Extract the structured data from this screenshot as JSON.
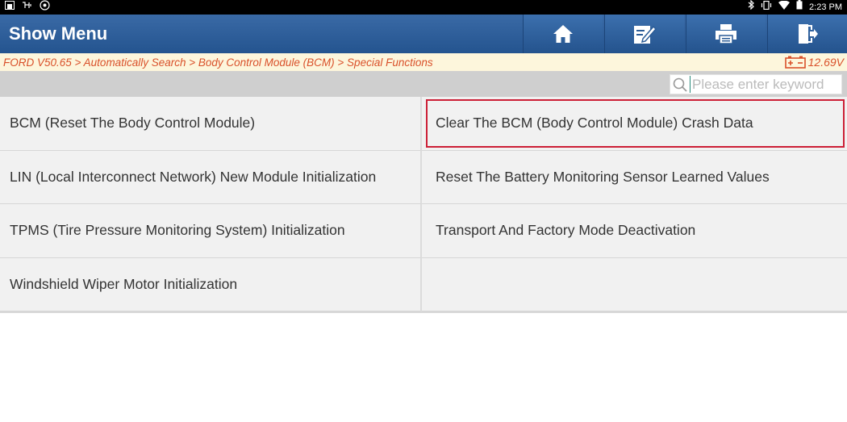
{
  "status_bar": {
    "left_icons": [
      "home-icon",
      "usb-debug-icon",
      "settings-icon"
    ],
    "right_icons": [
      "bluetooth-icon",
      "vibrate-icon",
      "wifi-icon",
      "battery-icon"
    ],
    "time": "2:23 PM"
  },
  "header": {
    "title": "Show Menu",
    "buttons": [
      {
        "name": "home-button",
        "icon": "home-icon"
      },
      {
        "name": "edit-button",
        "icon": "edit-icon"
      },
      {
        "name": "print-button",
        "icon": "print-icon"
      },
      {
        "name": "exit-button",
        "icon": "exit-icon"
      }
    ]
  },
  "breadcrumb": {
    "path": "FORD V50.65 > Automatically Search > Body Control Module (BCM) > Special Functions",
    "voltage": "12.69V",
    "voltage_icon": "battery-voltage-icon"
  },
  "search": {
    "placeholder": "Please enter keyword",
    "value": ""
  },
  "menu": {
    "items": [
      "BCM (Reset The Body Control Module)",
      "Clear The BCM (Body Control Module) Crash Data",
      "LIN (Local Interconnect Network) New Module Initialization",
      "Reset The Battery Monitoring Sensor Learned Values",
      "TPMS (Tire Pressure Monitoring System) Initialization",
      "Transport And Factory Mode Deactivation",
      "Windshield Wiper Motor Initialization",
      ""
    ],
    "selected_index": 1
  },
  "colors": {
    "title_bar": "#2b5c97",
    "breadcrumb_text": "#d9502a",
    "breadcrumb_bg": "#fdf6dc",
    "selection_border": "#cc1f36"
  }
}
